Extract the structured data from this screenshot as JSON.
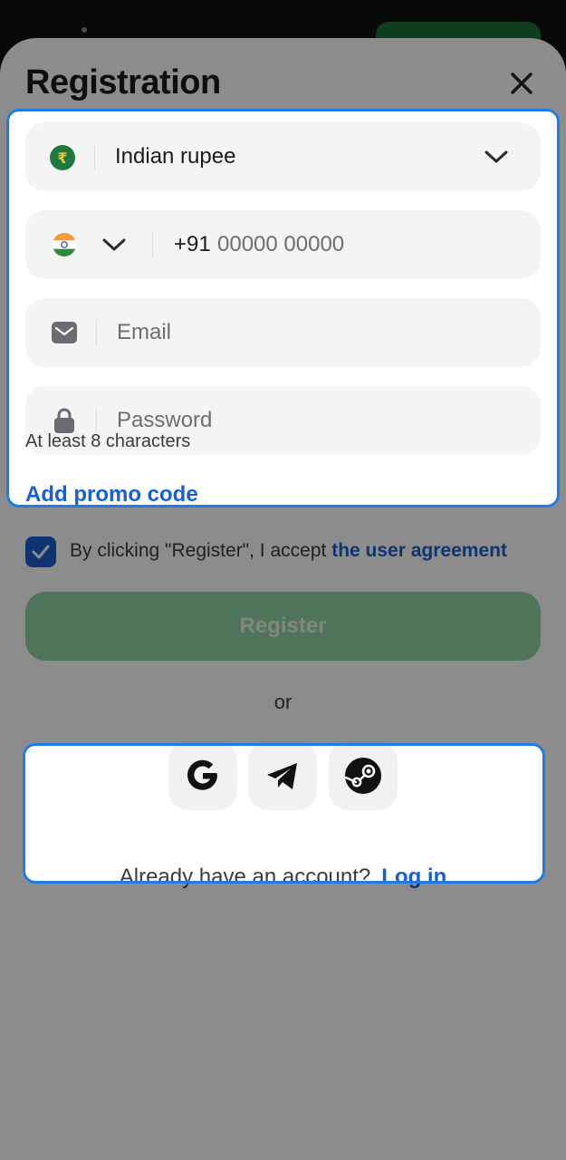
{
  "modal": {
    "title": "Registration",
    "currency": {
      "value": "Indian rupee",
      "symbol": "₹"
    },
    "phone": {
      "prefix": "+91",
      "placeholder": "00000 00000",
      "country": "India"
    },
    "email": {
      "placeholder": "Email"
    },
    "password": {
      "placeholder": "Password",
      "hint": "At least 8 characters"
    },
    "promo_link": "Add promo code",
    "agreement": {
      "checked": true,
      "text": "By clicking \"Register\", I accept",
      "link": "the user agreement"
    },
    "register_button": "Register",
    "or_label": "or",
    "social": [
      "google-icon",
      "telegram-icon",
      "steam-icon"
    ],
    "login_prompt": "Already have an account?",
    "login_link": "Log in"
  },
  "colors": {
    "accent": "#1a5fd0",
    "register": "#93d3a3",
    "highlight": "#1e7be8"
  }
}
